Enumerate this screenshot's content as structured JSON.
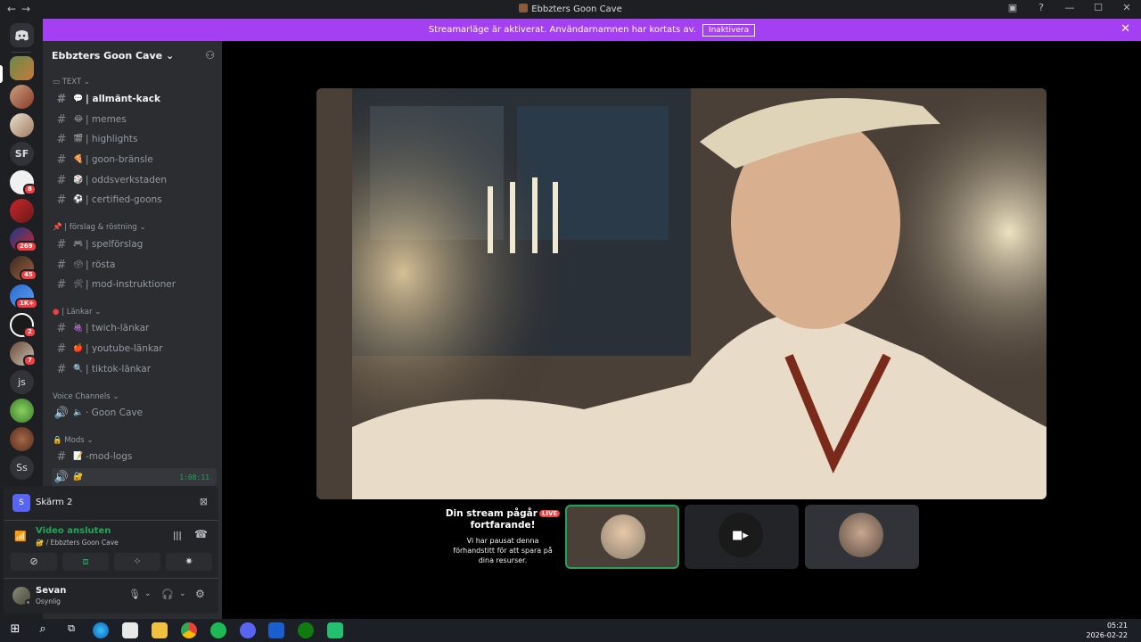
{
  "window": {
    "title": "Ebbzters Goon Cave"
  },
  "banner": {
    "text": "Streamarläge är aktiverat. Användarnamnen har kortats av.",
    "button": "Inaktivera"
  },
  "guilds": {
    "sf_label": "SF",
    "js_label": "js",
    "ss_label": "Ss",
    "badges": [
      "8",
      "269",
      "45",
      "1K+",
      "2",
      "7"
    ]
  },
  "server": {
    "name": "Ebbzters Goon Cave"
  },
  "categories": {
    "text": "TEXT",
    "forslag": "| förslag & röstning",
    "lankar": "| Länkar",
    "voice": "Voice Channels",
    "mods": "Mods"
  },
  "channels": {
    "c1": "| allmänt-kack",
    "c2": "| memes",
    "c3": "| highlights",
    "c4": "| goon-bränsle",
    "c5": "| oddsverkstaden",
    "c6": "| certified-goons",
    "c7": "| spelförslag",
    "c8": "| rösta",
    "c9": "| mod-instruktioner",
    "c10": "| twich-länkar",
    "c11": "| youtube-länkar",
    "c12": "| tiktok-länkar",
    "voice1": "· Goon Cave",
    "mod1": "-mod-logs",
    "timer": "1:08:11"
  },
  "panel": {
    "screen_name": "Skärm 2",
    "status": "Video ansluten",
    "channel": "/ Ebbzters Goon Cave",
    "user_name": "Sevan",
    "user_status": "Osynlig"
  },
  "stream": {
    "paused_title1": "Din stream pågår",
    "live_badge": "LIVE",
    "paused_title2": "fortfarande!",
    "paused_body": "Vi har pausat denna förhandstitt för att spara på dina resurser."
  },
  "clock": {
    "time": "05:21",
    "date": "2026-02-22"
  },
  "colors": {
    "accent": "#a43ff2",
    "green": "#23a559",
    "red": "#f23f43"
  }
}
